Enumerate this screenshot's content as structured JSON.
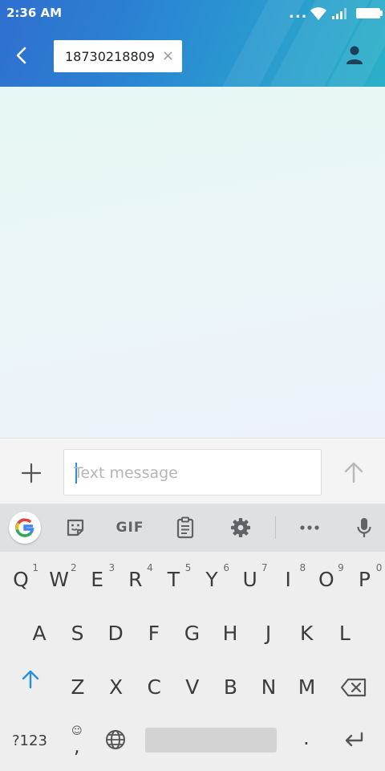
{
  "status_bar": {
    "time": "2:36 AM",
    "more_indicator": "...",
    "icons": [
      "wifi-icon",
      "signal-icon",
      "battery-icon"
    ]
  },
  "header": {
    "recipient_chip": "18730218809",
    "chip_close": "×"
  },
  "compose": {
    "placeholder": "Text message",
    "value": ""
  },
  "keyboard_toolbar": {
    "gif_label": "GIF",
    "more_label": "•••"
  },
  "keyboard": {
    "row1": [
      {
        "letter": "Q",
        "hint": "1"
      },
      {
        "letter": "W",
        "hint": "2"
      },
      {
        "letter": "E",
        "hint": "3"
      },
      {
        "letter": "R",
        "hint": "4"
      },
      {
        "letter": "T",
        "hint": "5"
      },
      {
        "letter": "Y",
        "hint": "6"
      },
      {
        "letter": "U",
        "hint": "7"
      },
      {
        "letter": "I",
        "hint": "8"
      },
      {
        "letter": "O",
        "hint": "9"
      },
      {
        "letter": "P",
        "hint": "0"
      }
    ],
    "row2": [
      "A",
      "S",
      "D",
      "F",
      "G",
      "H",
      "J",
      "K",
      "L"
    ],
    "row3": [
      "Z",
      "X",
      "C",
      "V",
      "B",
      "N",
      "M"
    ],
    "symbols_label": "?123",
    "comma": ",",
    "emoji_hint": "☺",
    "period": "."
  },
  "colors": {
    "header_gradient_start": "#2f6fcf",
    "header_gradient_end": "#2bb0c8",
    "accent_blue": "#2a8ed8",
    "key_text": "#3c3c3c"
  }
}
